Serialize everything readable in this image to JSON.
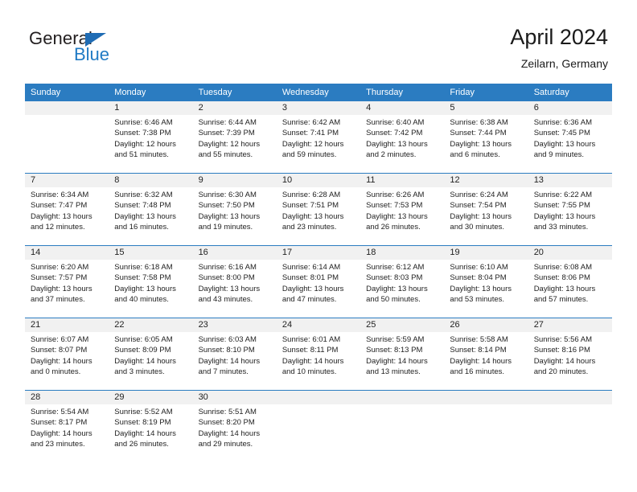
{
  "brand": {
    "name_top": "General",
    "name_bottom": "Blue",
    "triangle_color": "#1f6cb4",
    "blue_color": "#1f7ac4"
  },
  "header": {
    "title": "April 2024",
    "subtitle": "Zeilarn, Germany"
  },
  "theme": {
    "header_blue": "#2b7cc1",
    "day_band_gray": "#f1f1f1",
    "text": "#222222"
  },
  "weekdays": [
    "Sunday",
    "Monday",
    "Tuesday",
    "Wednesday",
    "Thursday",
    "Friday",
    "Saturday"
  ],
  "weeks": [
    {
      "numbers": [
        "",
        "1",
        "2",
        "3",
        "4",
        "5",
        "6"
      ],
      "details": [
        {
          "lines": []
        },
        {
          "lines": [
            "Sunrise: 6:46 AM",
            "Sunset: 7:38 PM",
            "Daylight: 12 hours",
            "and 51 minutes."
          ]
        },
        {
          "lines": [
            "Sunrise: 6:44 AM",
            "Sunset: 7:39 PM",
            "Daylight: 12 hours",
            "and 55 minutes."
          ]
        },
        {
          "lines": [
            "Sunrise: 6:42 AM",
            "Sunset: 7:41 PM",
            "Daylight: 12 hours",
            "and 59 minutes."
          ]
        },
        {
          "lines": [
            "Sunrise: 6:40 AM",
            "Sunset: 7:42 PM",
            "Daylight: 13 hours",
            "and 2 minutes."
          ]
        },
        {
          "lines": [
            "Sunrise: 6:38 AM",
            "Sunset: 7:44 PM",
            "Daylight: 13 hours",
            "and 6 minutes."
          ]
        },
        {
          "lines": [
            "Sunrise: 6:36 AM",
            "Sunset: 7:45 PM",
            "Daylight: 13 hours",
            "and 9 minutes."
          ]
        }
      ]
    },
    {
      "numbers": [
        "7",
        "8",
        "9",
        "10",
        "11",
        "12",
        "13"
      ],
      "details": [
        {
          "lines": [
            "Sunrise: 6:34 AM",
            "Sunset: 7:47 PM",
            "Daylight: 13 hours",
            "and 12 minutes."
          ]
        },
        {
          "lines": [
            "Sunrise: 6:32 AM",
            "Sunset: 7:48 PM",
            "Daylight: 13 hours",
            "and 16 minutes."
          ]
        },
        {
          "lines": [
            "Sunrise: 6:30 AM",
            "Sunset: 7:50 PM",
            "Daylight: 13 hours",
            "and 19 minutes."
          ]
        },
        {
          "lines": [
            "Sunrise: 6:28 AM",
            "Sunset: 7:51 PM",
            "Daylight: 13 hours",
            "and 23 minutes."
          ]
        },
        {
          "lines": [
            "Sunrise: 6:26 AM",
            "Sunset: 7:53 PM",
            "Daylight: 13 hours",
            "and 26 minutes."
          ]
        },
        {
          "lines": [
            "Sunrise: 6:24 AM",
            "Sunset: 7:54 PM",
            "Daylight: 13 hours",
            "and 30 minutes."
          ]
        },
        {
          "lines": [
            "Sunrise: 6:22 AM",
            "Sunset: 7:55 PM",
            "Daylight: 13 hours",
            "and 33 minutes."
          ]
        }
      ]
    },
    {
      "numbers": [
        "14",
        "15",
        "16",
        "17",
        "18",
        "19",
        "20"
      ],
      "details": [
        {
          "lines": [
            "Sunrise: 6:20 AM",
            "Sunset: 7:57 PM",
            "Daylight: 13 hours",
            "and 37 minutes."
          ]
        },
        {
          "lines": [
            "Sunrise: 6:18 AM",
            "Sunset: 7:58 PM",
            "Daylight: 13 hours",
            "and 40 minutes."
          ]
        },
        {
          "lines": [
            "Sunrise: 6:16 AM",
            "Sunset: 8:00 PM",
            "Daylight: 13 hours",
            "and 43 minutes."
          ]
        },
        {
          "lines": [
            "Sunrise: 6:14 AM",
            "Sunset: 8:01 PM",
            "Daylight: 13 hours",
            "and 47 minutes."
          ]
        },
        {
          "lines": [
            "Sunrise: 6:12 AM",
            "Sunset: 8:03 PM",
            "Daylight: 13 hours",
            "and 50 minutes."
          ]
        },
        {
          "lines": [
            "Sunrise: 6:10 AM",
            "Sunset: 8:04 PM",
            "Daylight: 13 hours",
            "and 53 minutes."
          ]
        },
        {
          "lines": [
            "Sunrise: 6:08 AM",
            "Sunset: 8:06 PM",
            "Daylight: 13 hours",
            "and 57 minutes."
          ]
        }
      ]
    },
    {
      "numbers": [
        "21",
        "22",
        "23",
        "24",
        "25",
        "26",
        "27"
      ],
      "details": [
        {
          "lines": [
            "Sunrise: 6:07 AM",
            "Sunset: 8:07 PM",
            "Daylight: 14 hours",
            "and 0 minutes."
          ]
        },
        {
          "lines": [
            "Sunrise: 6:05 AM",
            "Sunset: 8:09 PM",
            "Daylight: 14 hours",
            "and 3 minutes."
          ]
        },
        {
          "lines": [
            "Sunrise: 6:03 AM",
            "Sunset: 8:10 PM",
            "Daylight: 14 hours",
            "and 7 minutes."
          ]
        },
        {
          "lines": [
            "Sunrise: 6:01 AM",
            "Sunset: 8:11 PM",
            "Daylight: 14 hours",
            "and 10 minutes."
          ]
        },
        {
          "lines": [
            "Sunrise: 5:59 AM",
            "Sunset: 8:13 PM",
            "Daylight: 14 hours",
            "and 13 minutes."
          ]
        },
        {
          "lines": [
            "Sunrise: 5:58 AM",
            "Sunset: 8:14 PM",
            "Daylight: 14 hours",
            "and 16 minutes."
          ]
        },
        {
          "lines": [
            "Sunrise: 5:56 AM",
            "Sunset: 8:16 PM",
            "Daylight: 14 hours",
            "and 20 minutes."
          ]
        }
      ]
    },
    {
      "numbers": [
        "28",
        "29",
        "30",
        "",
        "",
        "",
        ""
      ],
      "details": [
        {
          "lines": [
            "Sunrise: 5:54 AM",
            "Sunset: 8:17 PM",
            "Daylight: 14 hours",
            "and 23 minutes."
          ]
        },
        {
          "lines": [
            "Sunrise: 5:52 AM",
            "Sunset: 8:19 PM",
            "Daylight: 14 hours",
            "and 26 minutes."
          ]
        },
        {
          "lines": [
            "Sunrise: 5:51 AM",
            "Sunset: 8:20 PM",
            "Daylight: 14 hours",
            "and 29 minutes."
          ]
        },
        {
          "lines": []
        },
        {
          "lines": []
        },
        {
          "lines": []
        },
        {
          "lines": []
        }
      ]
    }
  ]
}
